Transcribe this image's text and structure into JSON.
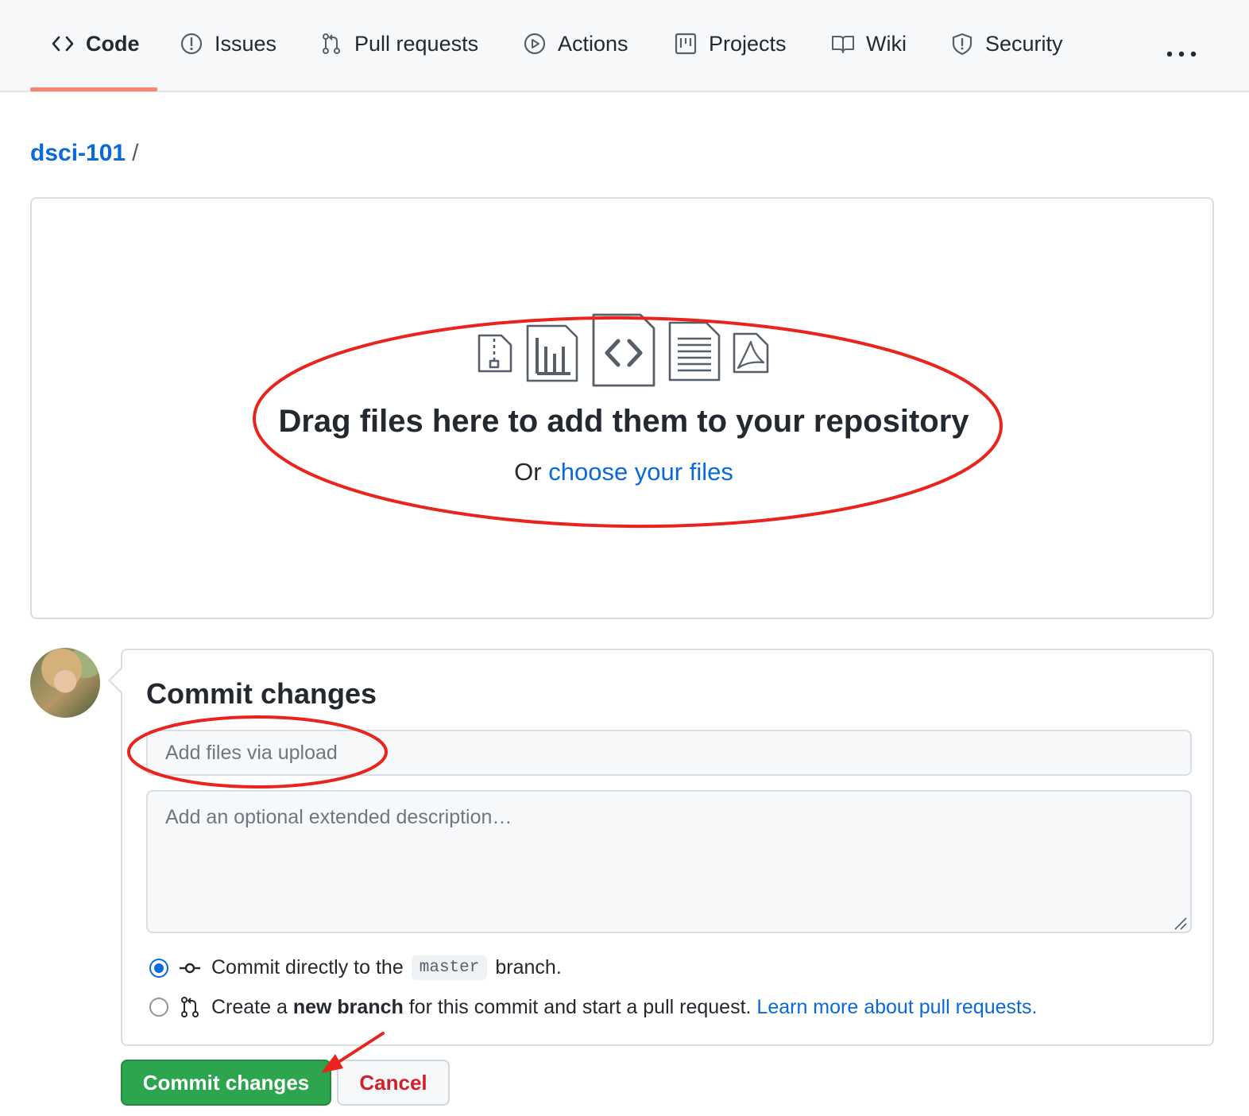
{
  "nav": {
    "tabs": [
      {
        "label": "Code",
        "icon": "code-icon",
        "active": true
      },
      {
        "label": "Issues",
        "icon": "issue-icon"
      },
      {
        "label": "Pull requests",
        "icon": "pull-request-icon"
      },
      {
        "label": "Actions",
        "icon": "play-icon"
      },
      {
        "label": "Projects",
        "icon": "project-board-icon"
      },
      {
        "label": "Wiki",
        "icon": "book-icon"
      },
      {
        "label": "Security",
        "icon": "shield-icon"
      }
    ],
    "more_icon": "kebab-horizontal-icon"
  },
  "breadcrumb": {
    "repo": "dsci-101",
    "separator": "/"
  },
  "dropzone": {
    "file_icons": [
      "file-zip-icon",
      "file-chart-icon",
      "file-code-icon",
      "file-text-icon",
      "file-pdf-icon"
    ],
    "title": "Drag files here to add them to your repository",
    "or_text": "Or",
    "choose_link": "choose your files"
  },
  "commit": {
    "title": "Commit changes",
    "summary_placeholder": "Add files via upload",
    "description_placeholder": "Add an optional extended description…",
    "options": {
      "direct": {
        "pre": "Commit directly to the",
        "branch": "master",
        "post": "branch.",
        "checked": true
      },
      "new_branch": {
        "pre": "Create a",
        "bold": "new branch",
        "post": "for this commit and start a pull request.",
        "link": "Learn more about pull requests.",
        "checked": false
      }
    }
  },
  "buttons": {
    "commit": "Commit changes",
    "cancel": "Cancel"
  },
  "colors": {
    "accent": "#0969da",
    "primary_button": "#2da44e",
    "danger": "#cf222e",
    "tab_underline": "#f9826c",
    "annotation": "#e8241d"
  }
}
